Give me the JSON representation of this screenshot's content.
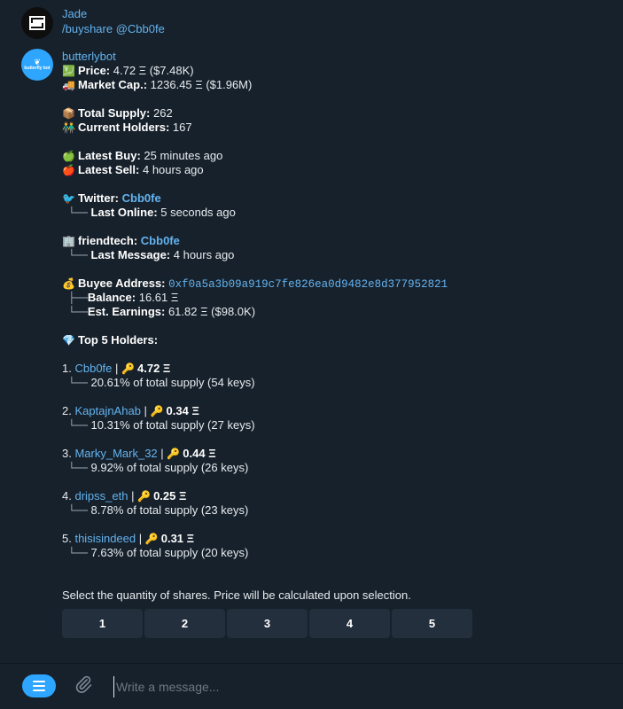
{
  "jade": {
    "name": "Jade",
    "command": "/buyshare @Cbb0fe"
  },
  "bot": {
    "name": "butterlybot",
    "avatar_text": "butterfly bot",
    "price_label": "Price:",
    "price_value": "4.72 Ξ ($7.48K)",
    "mcap_label": "Market Cap.:",
    "mcap_value": "1236.45 Ξ ($1.96M)",
    "supply_label": "Total Supply:",
    "supply_value": "262",
    "holders_label": "Current Holders:",
    "holders_value": "167",
    "buy_label": "Latest Buy:",
    "buy_value": "25 minutes ago",
    "sell_label": "Latest Sell:",
    "sell_value": "4 hours ago",
    "twitter_label": "Twitter:",
    "twitter_handle": "Cbb0fe",
    "online_label": "Last Online:",
    "online_value": "5 seconds ago",
    "ft_label": "friendtech:",
    "ft_handle": "Cbb0fe",
    "lastmsg_label": "Last Message:",
    "lastmsg_value": "4 hours ago",
    "buyee_label": "Buyee Address:",
    "buyee_address": "0xf0a5a3b09a919c7fe826ea0d9482e8d377952821",
    "balance_label": "Balance:",
    "balance_value": "16.61 Ξ",
    "earn_label": "Est. Earnings:",
    "earn_value": "61.82 Ξ ($98.0K)",
    "top_label": "Top 5 Holders:",
    "holders": [
      {
        "num": "1.",
        "name": "Cbb0fe",
        "value": "4.72 Ξ",
        "supply": "20.61% of total supply (54 keys)"
      },
      {
        "num": "2.",
        "name": "KaptajnAhab",
        "value": "0.34 Ξ",
        "supply": "10.31% of total supply (27 keys)"
      },
      {
        "num": "3.",
        "name": "Marky_Mark_32",
        "value": "0.44 Ξ",
        "supply": "9.92% of total supply (26 keys)"
      },
      {
        "num": "4.",
        "name": "dripss_eth",
        "value": "0.25 Ξ",
        "supply": "8.78% of total supply (23 keys)"
      },
      {
        "num": "5.",
        "name": "thisisindeed",
        "value": "0.31 Ξ",
        "supply": "7.63% of total supply (20 keys)"
      }
    ],
    "select_text": "Select the quantity of shares. Price will be calculated upon selection.",
    "buttons": [
      "1",
      "2",
      "3",
      "4",
      "5"
    ]
  },
  "icons": {
    "price": "💹",
    "mcap": "🚚",
    "supply": "📦",
    "holders": "👬",
    "buy": "🍏",
    "sell": "🍎",
    "twitter": "🐦",
    "ft": "🏢",
    "buyee": "💰",
    "diamond": "💎",
    "key": "🔑"
  },
  "composer": {
    "placeholder": "Write a message..."
  },
  "colors": {
    "background": "#17212b",
    "link": "#63b3f0",
    "accent": "#2ea6ff",
    "keyboard_button": "#242f3d"
  }
}
